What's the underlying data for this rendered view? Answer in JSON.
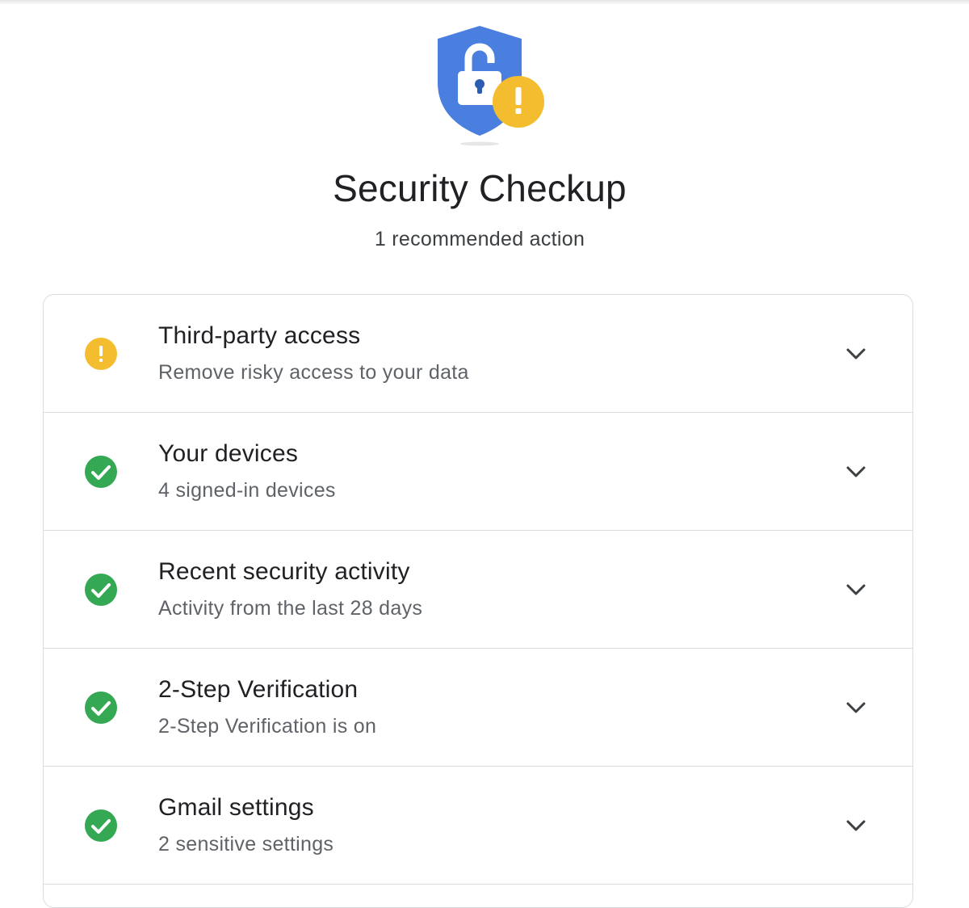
{
  "header": {
    "title": "Security Checkup",
    "subtitle": "1 recommended action",
    "hero_icon": "shield-unlocked-warning-icon"
  },
  "colors": {
    "shield_blue": "#4a7fe0",
    "warning_yellow": "#f3bd2f",
    "success_green": "#34a853",
    "divider": "#dadce0"
  },
  "items": [
    {
      "title": "Third-party access",
      "description": "Remove risky access to your data",
      "status": "warning",
      "icon": "warning-icon"
    },
    {
      "title": "Your devices",
      "description": "4 signed-in devices",
      "status": "ok",
      "icon": "check-circle-icon"
    },
    {
      "title": "Recent security activity",
      "description": "Activity from the last 28 days",
      "status": "ok",
      "icon": "check-circle-icon"
    },
    {
      "title": "2-Step Verification",
      "description": "2-Step Verification is on",
      "status": "ok",
      "icon": "check-circle-icon"
    },
    {
      "title": "Gmail settings",
      "description": "2 sensitive settings",
      "status": "ok",
      "icon": "check-circle-icon"
    }
  ]
}
